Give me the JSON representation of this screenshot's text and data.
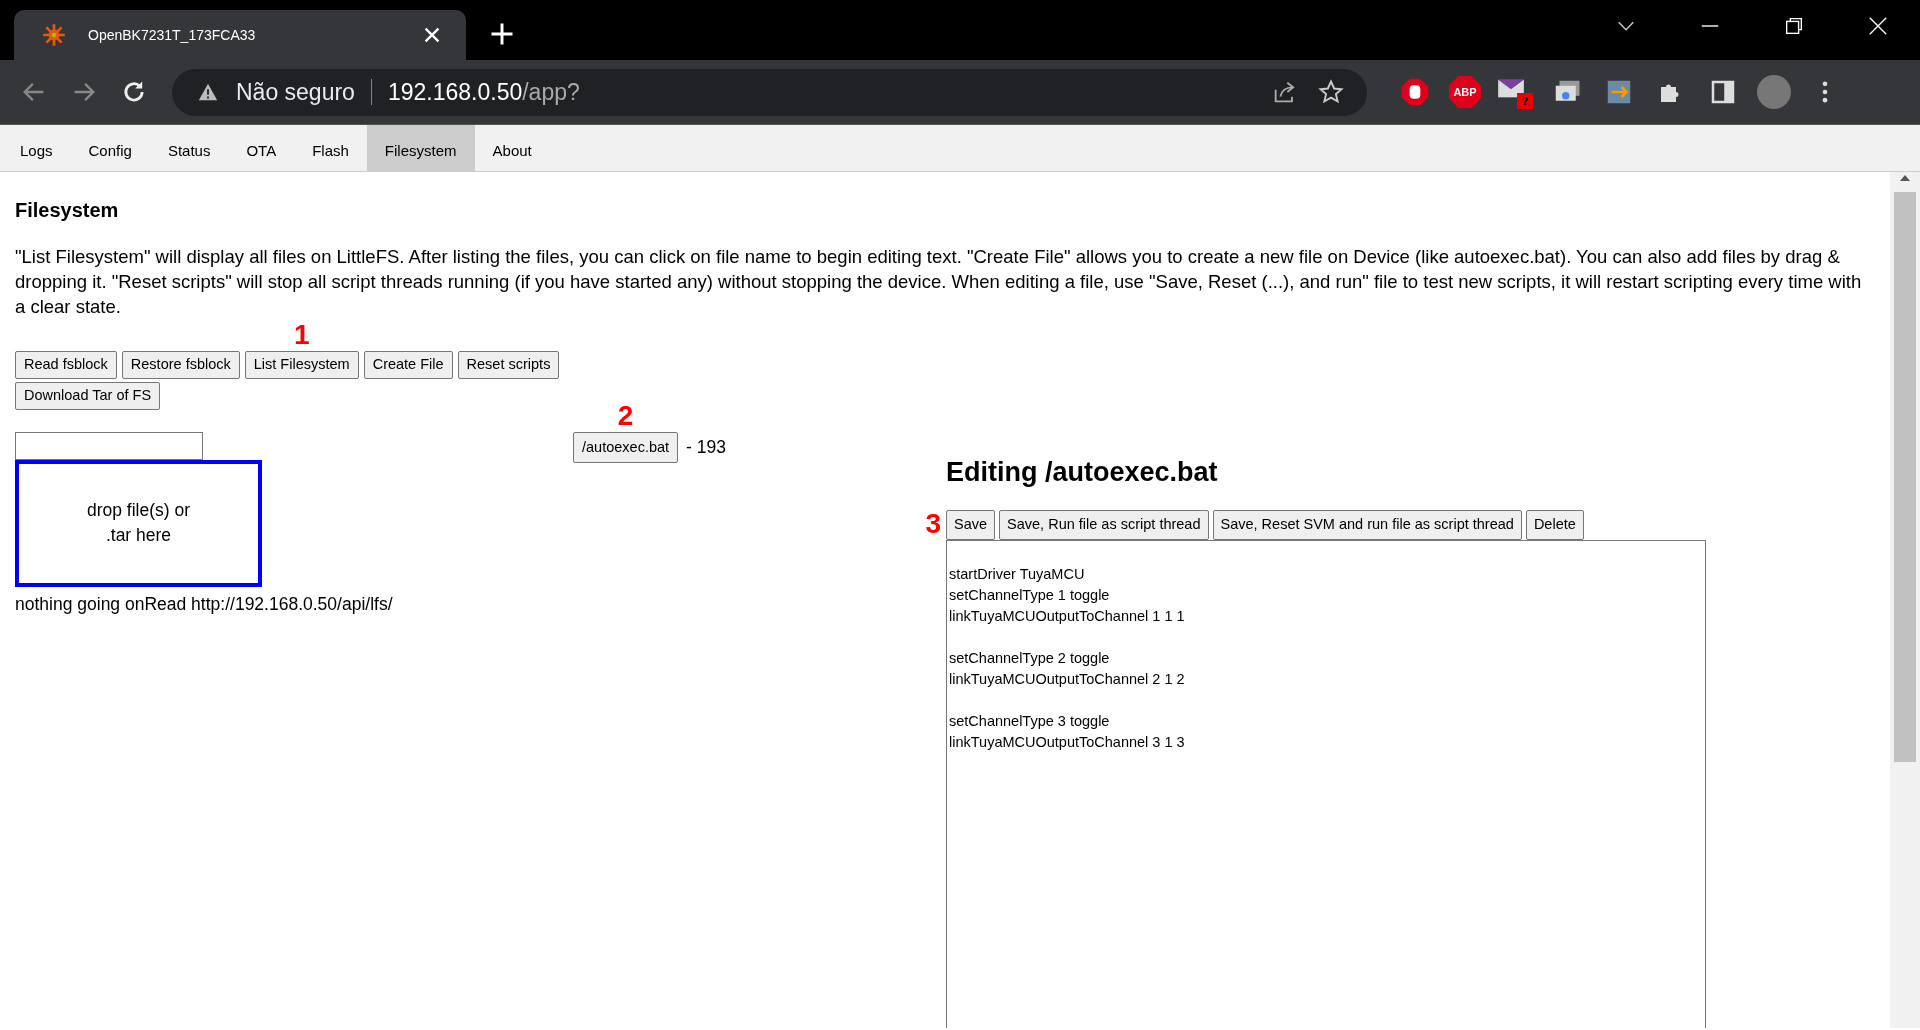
{
  "browser": {
    "tab_title": "OpenBK7231T_173FCA33",
    "security_label": "Não seguro",
    "address_host": "192.168.0.50",
    "address_path": "/app?",
    "extensions": [
      {
        "kind": "stop"
      },
      {
        "kind": "abp",
        "label": "ABP"
      },
      {
        "kind": "mail",
        "badge": "?"
      },
      {
        "kind": "cast"
      },
      {
        "kind": "transfer"
      },
      {
        "kind": "puzzle"
      },
      {
        "kind": "sidepanel"
      }
    ]
  },
  "nav_tabs": [
    {
      "label": "Logs",
      "selected": false
    },
    {
      "label": "Config",
      "selected": false
    },
    {
      "label": "Status",
      "selected": false
    },
    {
      "label": "OTA",
      "selected": false
    },
    {
      "label": "Flash",
      "selected": false
    },
    {
      "label": "Filesystem",
      "selected": true
    },
    {
      "label": "About",
      "selected": false
    }
  ],
  "page": {
    "heading": "Filesystem",
    "description": "\"List Filesystem\" will display all files on LittleFS. After listing the files, you can click on file name to begin editing text. \"Create File\" allows you to create a new file on Device (like autoexec.bat). You can also add files by drag & dropping it. \"Reset scripts\" will stop all script threads running (if you have started any) without stopping the device. When editing a file, use \"Save, Reset (...), and run\" file to test new scripts, it will restart scripting every time with a clear state.",
    "buttons": [
      {
        "label": "Read fsblock"
      },
      {
        "label": "Restore fsblock"
      },
      {
        "label": "List Filesystem",
        "annotation": "1"
      },
      {
        "label": "Create File"
      },
      {
        "label": "Reset scripts"
      },
      {
        "label": "Download Tar of FS"
      }
    ],
    "drop_zone": "drop file(s) or .tar here",
    "status": "nothing going onRead http://192.168.0.50/api/lfs/",
    "files": [
      {
        "name": "/autoexec.bat",
        "size": "- 193",
        "annotation": "2"
      }
    ],
    "editor": {
      "heading": "Editing /autoexec.bat",
      "buttons": [
        {
          "label": "Save",
          "annotation": "3"
        },
        {
          "label": "Save, Run file as script thread"
        },
        {
          "label": "Save, Reset SVM and run file as script thread"
        },
        {
          "label": "Delete"
        }
      ],
      "value": "\nstartDriver TuyaMCU\nsetChannelType 1 toggle\nlinkTuyaMCUOutputToChannel 1 1 1\n\nsetChannelType 2 toggle\nlinkTuyaMCUOutputToChannel 2 1 2\n\nsetChannelType 3 toggle\nlinkTuyaMCUOutputToChannel 3 1 3"
    }
  }
}
